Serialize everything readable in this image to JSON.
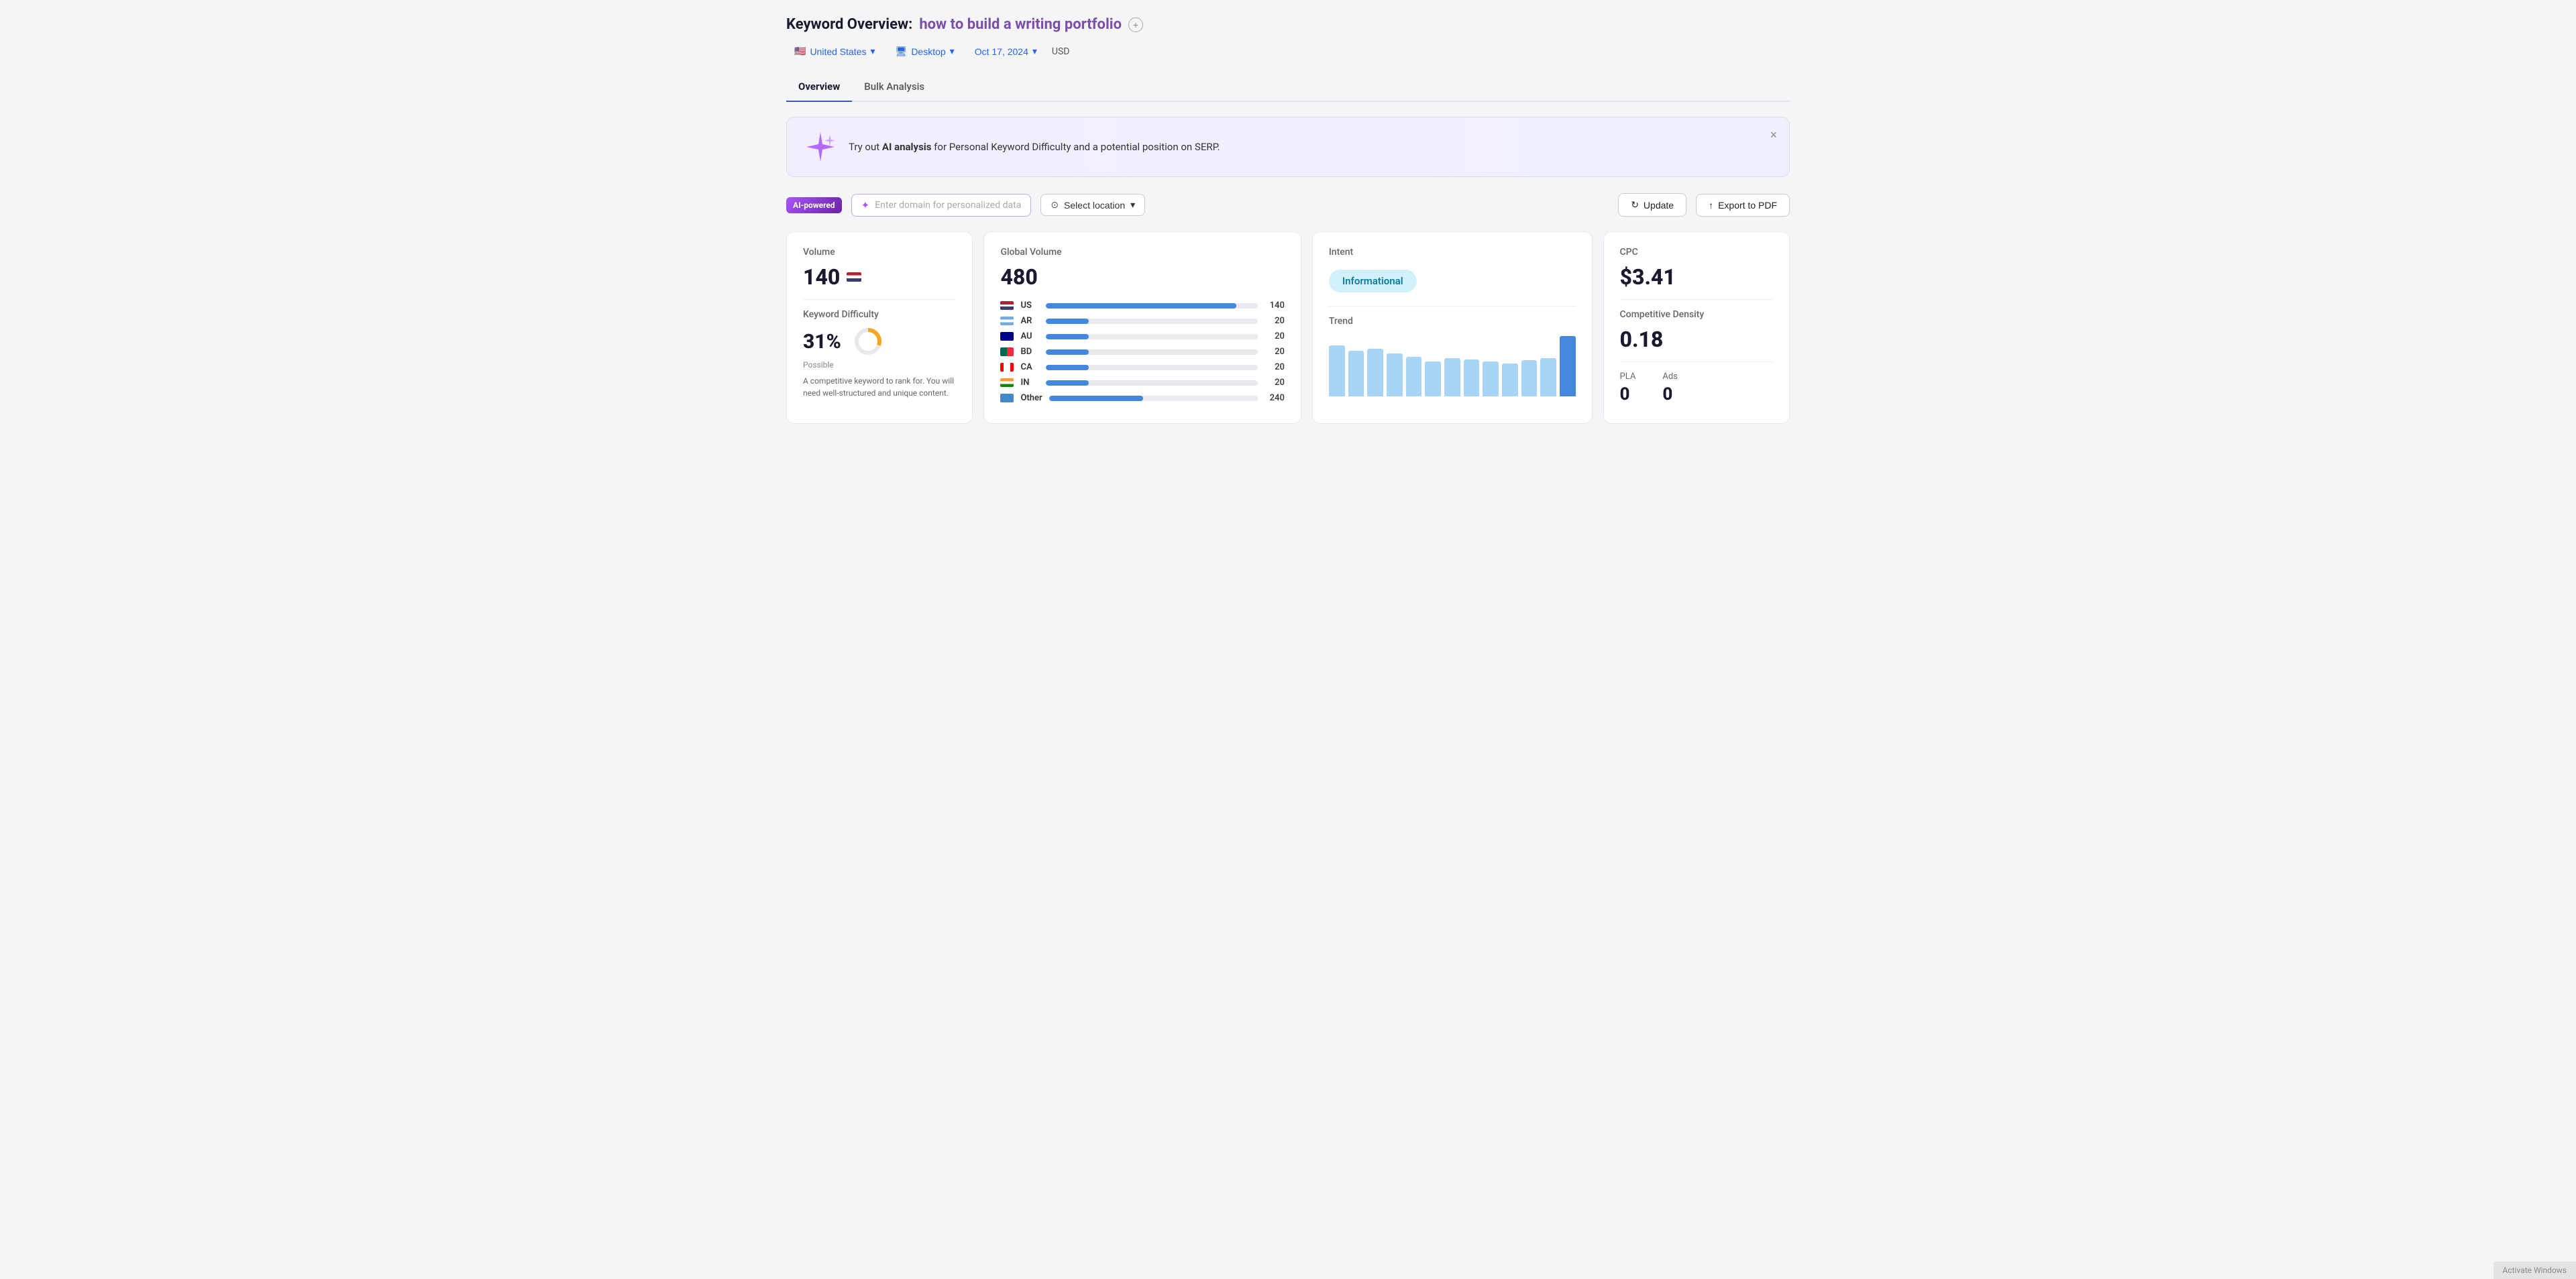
{
  "header": {
    "title_static": "Keyword Overview:",
    "title_keyword": "how to build a writing portfolio",
    "add_button_label": "+"
  },
  "filter_bar": {
    "country": "United States",
    "device": "Desktop",
    "date": "Oct 17, 2024",
    "currency": "USD"
  },
  "tabs": [
    {
      "label": "Overview",
      "active": true
    },
    {
      "label": "Bulk Analysis",
      "active": false
    }
  ],
  "ai_banner": {
    "text_prefix": "Try out ",
    "text_link": "AI analysis",
    "text_suffix": " for Personal Keyword Difficulty and a potential position on SERP.",
    "close_label": "×"
  },
  "ai_tools": {
    "badge_label": "AI-powered",
    "domain_placeholder": "Enter domain for personalized data",
    "location_label": "Select location",
    "update_label": "Update",
    "export_label": "Export to PDF"
  },
  "volume_card": {
    "label": "Volume",
    "value": "140"
  },
  "keyword_difficulty_card": {
    "label": "Keyword Difficulty",
    "value": "31%",
    "sub_label": "Possible",
    "description": "A competitive keyword to rank for. You will need well-structured and unique content.",
    "donut_percent": 31
  },
  "global_volume_card": {
    "label": "Global Volume",
    "value": "480",
    "countries": [
      {
        "code": "US",
        "flag_class": "flag-us",
        "count": 140,
        "bar_pct": 90
      },
      {
        "code": "AR",
        "flag_class": "flag-ar",
        "count": 20,
        "bar_pct": 20
      },
      {
        "code": "AU",
        "flag_class": "flag-au",
        "count": 20,
        "bar_pct": 20
      },
      {
        "code": "BD",
        "flag_class": "flag-bd",
        "count": 20,
        "bar_pct": 20
      },
      {
        "code": "CA",
        "flag_class": "flag-ca",
        "count": 20,
        "bar_pct": 20
      },
      {
        "code": "IN",
        "flag_class": "flag-in",
        "count": 20,
        "bar_pct": 20
      },
      {
        "code": "Other",
        "flag_class": "flag-other",
        "count": 240,
        "bar_pct": 45
      }
    ]
  },
  "intent_card": {
    "label": "Intent",
    "badge_label": "Informational"
  },
  "trend_card": {
    "label": "Trend",
    "bars": [
      80,
      72,
      75,
      68,
      62,
      55,
      60,
      58,
      55,
      52,
      57,
      60,
      95
    ]
  },
  "cpc_card": {
    "label": "CPC",
    "value": "$3.41"
  },
  "competitive_density_card": {
    "label": "Competitive Density",
    "value": "0.18"
  },
  "pla_ads_card": {
    "pla_label": "PLA",
    "pla_value": "0",
    "ads_label": "Ads",
    "ads_value": "0"
  },
  "activate_windows": "Activate Windows"
}
